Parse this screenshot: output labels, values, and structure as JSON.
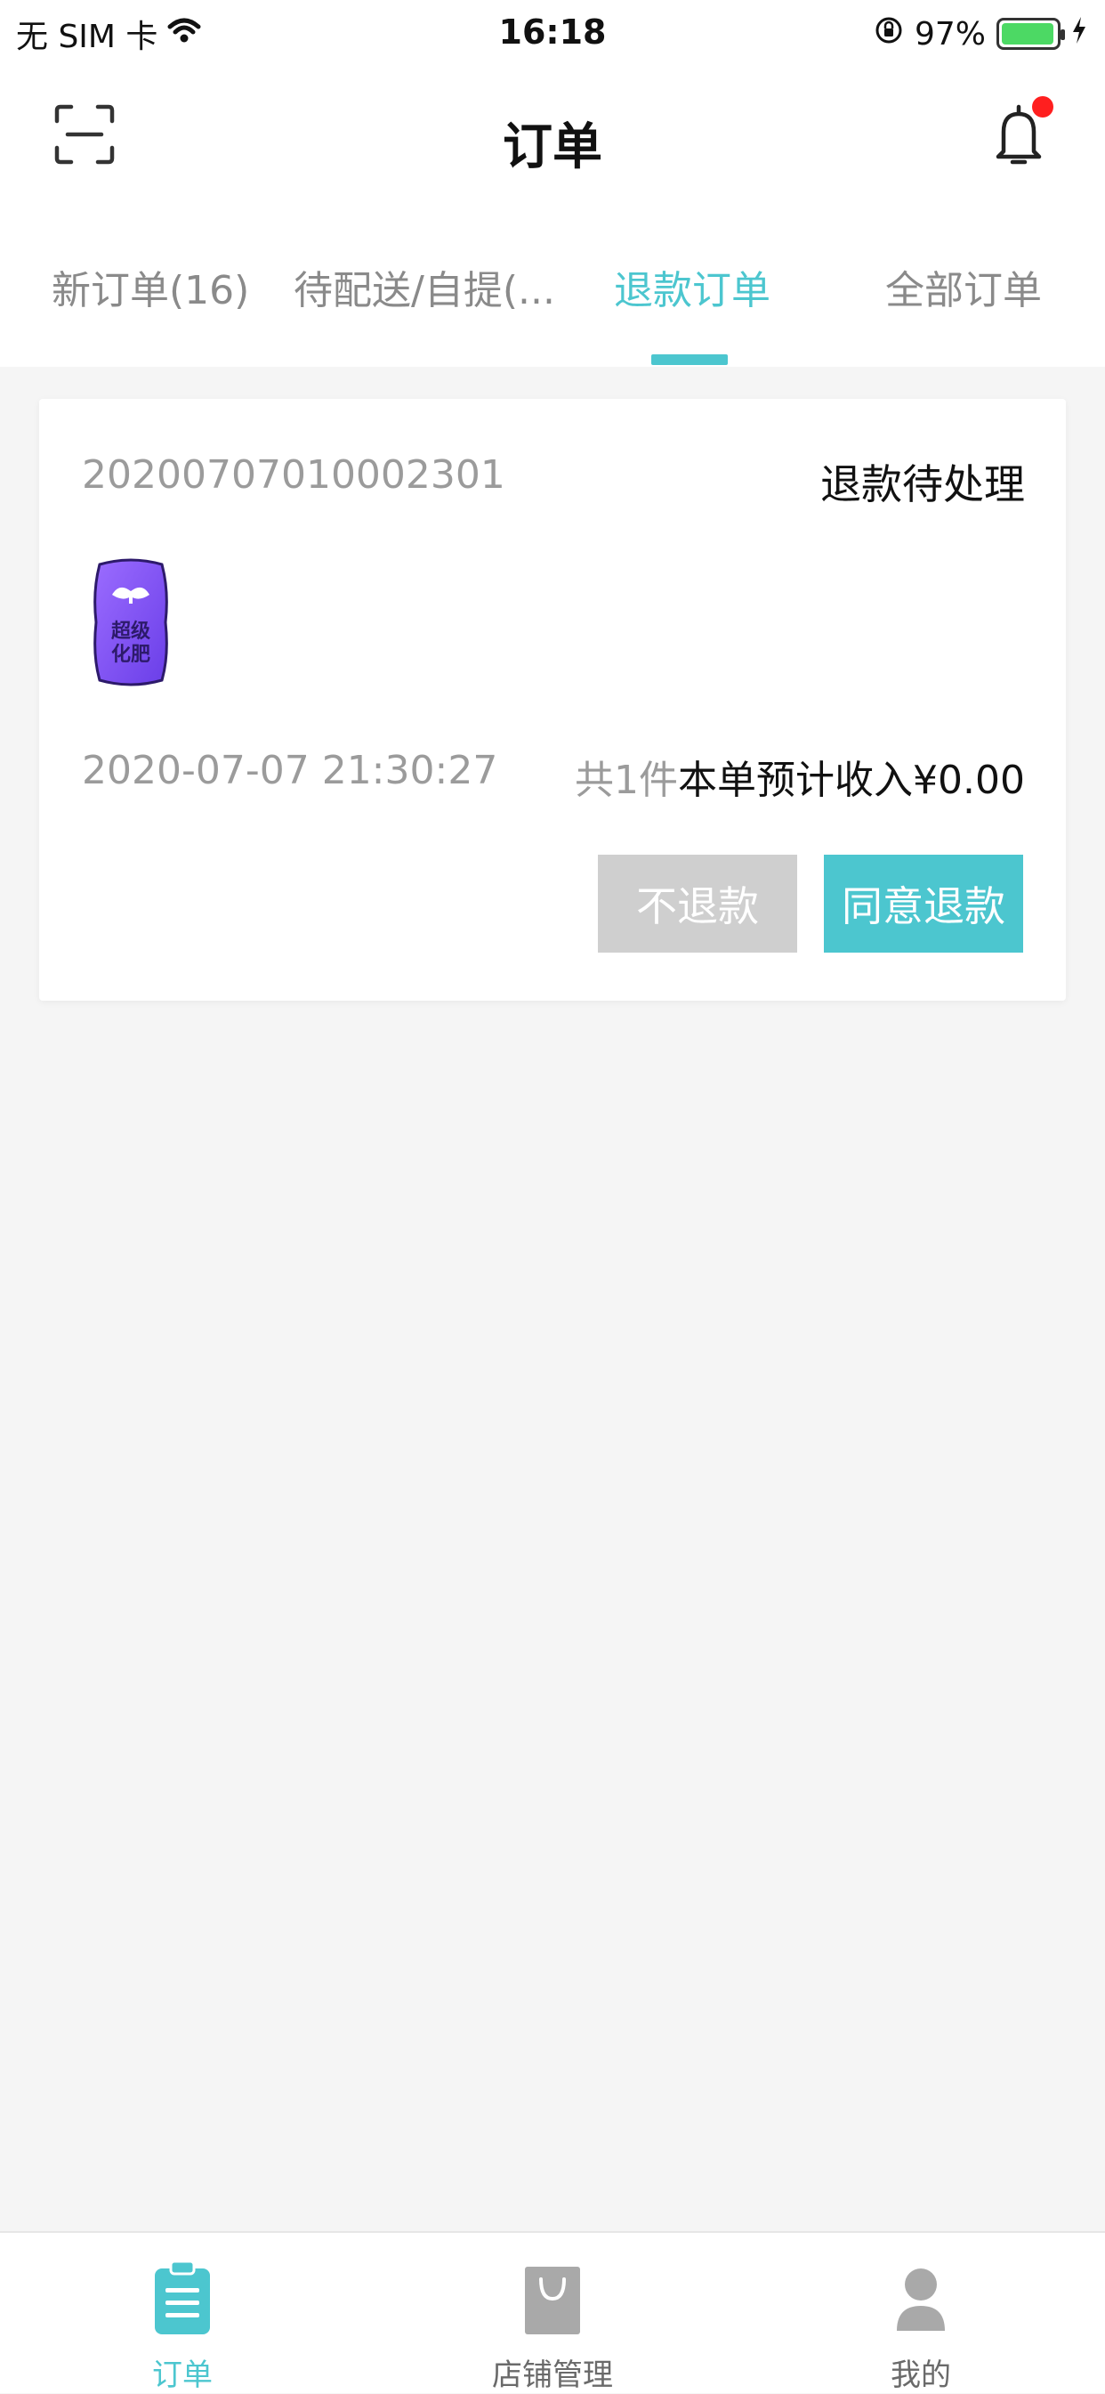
{
  "status_bar": {
    "carrier": "无 SIM 卡",
    "time": "16:18",
    "battery": "97%",
    "battery_level": 0.97
  },
  "nav": {
    "title": "订单"
  },
  "tabs": [
    {
      "label": "新订单(16)"
    },
    {
      "label": "待配送/自提(..."
    },
    {
      "label": "退款订单"
    },
    {
      "label": "全部订单"
    }
  ],
  "order": {
    "number": "20200707010002301",
    "status": "退款待处理",
    "product_image_text": "超级化肥",
    "date": "2020-07-07 21:30:27",
    "count": "共1件",
    "income": "本单预计收入¥0.00",
    "reject_label": "不退款",
    "agree_label": "同意退款"
  },
  "bottom_tabs": [
    {
      "label": "订单",
      "icon": "clipboard-icon"
    },
    {
      "label": "店铺管理",
      "icon": "shopping-bag-icon"
    },
    {
      "label": "我的",
      "icon": "user-icon"
    }
  ],
  "colors": {
    "accent": "#4cc6cf",
    "badge": "#ff1f1f",
    "gray_button": "#cfcfcf"
  }
}
